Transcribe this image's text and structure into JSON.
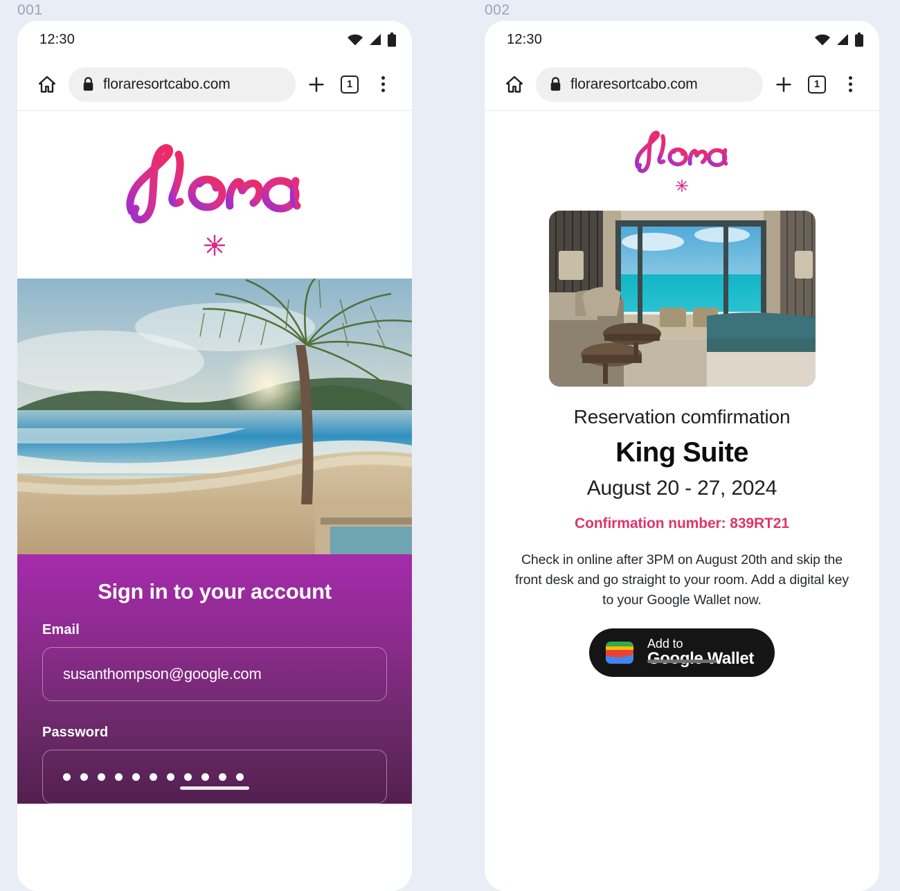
{
  "background_color": "#e9edf6",
  "frames": [
    {
      "label": "001"
    },
    {
      "label": "002"
    }
  ],
  "status_bar": {
    "time": "12:30",
    "icons": [
      "wifi-icon",
      "cell-signal-icon",
      "battery-icon"
    ]
  },
  "browser": {
    "home_icon": "home-icon",
    "lock_icon": "lock-icon",
    "url": "floraresortcabo.com",
    "new_tab_icon": "plus-icon",
    "tab_count": "1",
    "menu_icon": "more-vertical-icon"
  },
  "brand": {
    "wordmark": "Flora",
    "spark_icon": "flower-spark-icon",
    "gradient_start": "#e8256b",
    "gradient_end": "#9b2fd0",
    "accent_pink": "#de3569",
    "panel_top": "#a52bab",
    "panel_bottom": "#53204f"
  },
  "screen_signin": {
    "hero_image_alt": "tropical beach at sunset with palm tree",
    "title": "Sign in to your account",
    "fields": [
      {
        "label": "Email",
        "value": "susanthompson@google.com",
        "placeholder": "Email",
        "type": "email"
      },
      {
        "label": "Password",
        "value": "•••••••••••",
        "placeholder": "Password",
        "type": "password",
        "dot_count": 11
      }
    ]
  },
  "screen_confirmation": {
    "room_image_alt": "hotel suite interior with ocean view balcony",
    "subtitle": "Reservation comfirmation",
    "room_name": "King Suite",
    "dates": "August 20 - 27, 2024",
    "confirmation_number": "Confirmation number: 839RT21",
    "note": "Check in online after 3PM on August 20th and skip the front desk and go straight to your room. Add a digital key to your Google Wallet now.",
    "wallet_button": {
      "icon": "google-wallet-icon",
      "line1": "Add to",
      "line2": "Google Wallet"
    }
  }
}
